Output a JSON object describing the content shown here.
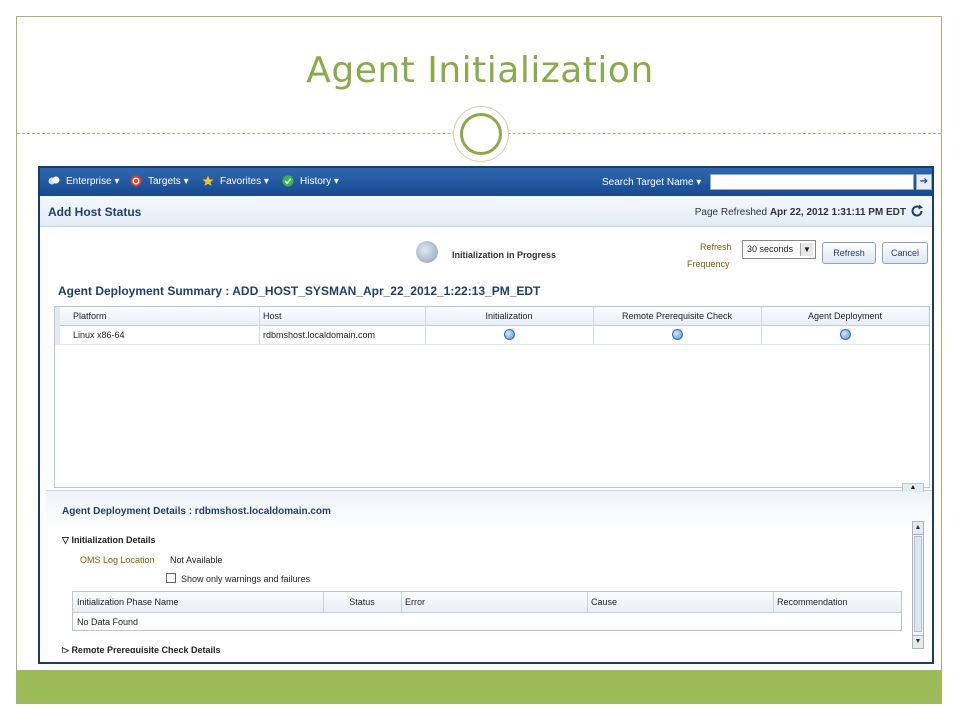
{
  "slide": {
    "title": "Agent Initialization"
  },
  "nav": {
    "items": [
      {
        "label": "Enterprise",
        "icon": "enterprise-icon"
      },
      {
        "label": "Targets",
        "icon": "targets-icon"
      },
      {
        "label": "Favorites",
        "icon": "star-icon"
      },
      {
        "label": "History",
        "icon": "history-icon"
      }
    ],
    "search_label": "Search Target Name ▾",
    "search_value": ""
  },
  "page": {
    "title": "Add Host Status",
    "refreshed_prefix": "Page Refreshed",
    "refreshed_time": "Apr 22, 2012 1:31:11 PM EDT"
  },
  "status": {
    "progress_text": "Initialization in Progress",
    "refresh_label_1": "Refresh",
    "refresh_label_2": "Frequency",
    "frequency_value": "30 seconds",
    "refresh_button": "Refresh",
    "cancel_button": "Cancel"
  },
  "summary": {
    "title": "Agent Deployment Summary : ADD_HOST_SYSMAN_Apr_22_2012_1:22:13_PM_EDT",
    "columns": [
      "Platform",
      "Host",
      "Initialization",
      "Remote Prerequisite Check",
      "Agent Deployment"
    ],
    "rows": [
      {
        "platform": "Linux x86-64",
        "host": "rdbmshost.localdomain.com",
        "initialization": "in-progress",
        "remote_check": "in-progress",
        "agent_deployment": "in-progress"
      }
    ]
  },
  "details": {
    "title": "Agent Deployment Details : rdbmshost.localdomain.com",
    "init_section": "Initialization Details",
    "oms_label": "OMS Log Location",
    "oms_value": "Not Available",
    "checkbox_label": "Show only warnings and failures",
    "phase_columns": [
      "Initialization Phase Name",
      "Status",
      "Error",
      "Cause",
      "Recommendation"
    ],
    "empty_text": "No Data Found",
    "remote_section": "Remote Prerequisite Check Details"
  },
  "colors": {
    "accent_green": "#8aab4a",
    "nav_blue": "#174a8f",
    "status_dot": "#4d8fd3"
  }
}
